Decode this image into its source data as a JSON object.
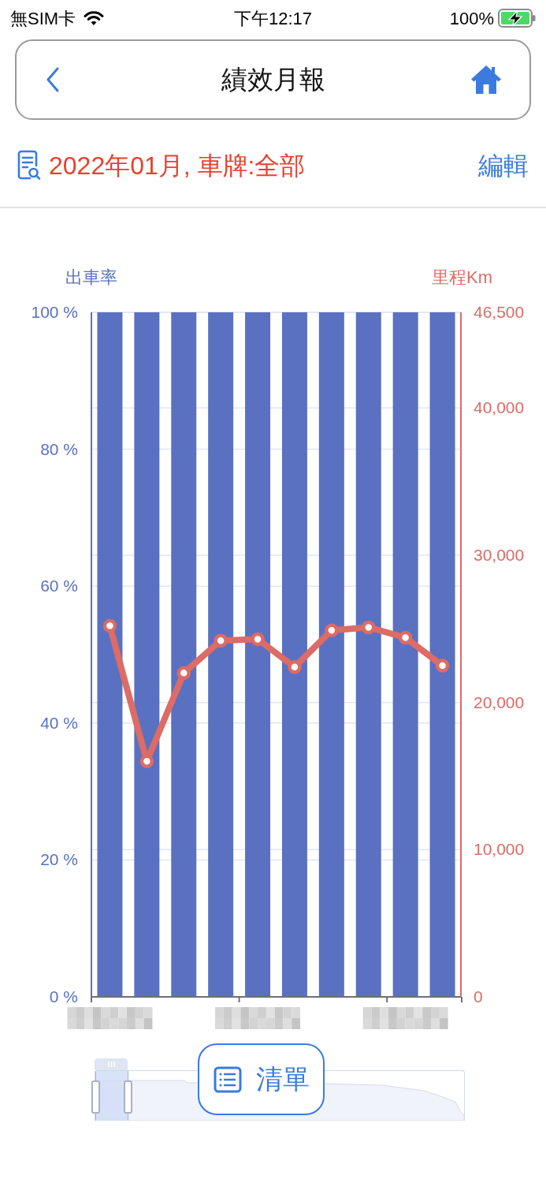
{
  "status_bar": {
    "carrier": "無SIM卡",
    "time": "下午12:17",
    "battery": "100%"
  },
  "header": {
    "title": "績效月報"
  },
  "filter": {
    "summary": "2022年01月, 車牌:全部",
    "edit_button": "編輯"
  },
  "chart": {
    "charts": [
      {
        "chart_data": {
          "type": "bar",
          "ylabel": "出車率",
          "ylim": [
            0,
            100
          ],
          "yticks": [
            {
              "value": 0,
              "label": "0 %"
            },
            {
              "value": 20,
              "label": "20 %"
            },
            {
              "value": 40,
              "label": "40 %"
            },
            {
              "value": 60,
              "label": "60 %"
            },
            {
              "value": 80,
              "label": "80 %"
            },
            {
              "value": 100,
              "label": "100 %"
            }
          ],
          "grid": true,
          "series": [
            {
              "color": "#5a71c1",
              "values": [
                100,
                100,
                100,
                100,
                100,
                100,
                100,
                100,
                100,
                100
              ]
            }
          ]
        }
      },
      {
        "chart_data": {
          "type": "line",
          "ylabel": "里程Km",
          "ylim": [
            0,
            46500
          ],
          "yticks": [
            {
              "value": 0,
              "label": "0"
            },
            {
              "value": 10000,
              "label": "10,000"
            },
            {
              "value": 20000,
              "label": "20,000"
            },
            {
              "value": 30000,
              "label": "30,000"
            },
            {
              "value": 40000,
              "label": "40,000"
            },
            {
              "value": 46500,
              "label": "46,500"
            }
          ],
          "grid": true,
          "series": [
            {
              "color": "#dd6b66",
              "marker": "circle",
              "values": [
                25200,
                16000,
                22000,
                24200,
                24300,
                22400,
                24900,
                25100,
                24400,
                22500
              ]
            }
          ]
        }
      }
    ],
    "redacted_labels": [
      {
        "kind": "blurred"
      },
      {
        "kind": "blurred"
      },
      {
        "kind": "blurred"
      }
    ],
    "data_zoom": {
      "level": 0.09
    }
  },
  "list_button": {
    "label": "清單"
  }
}
